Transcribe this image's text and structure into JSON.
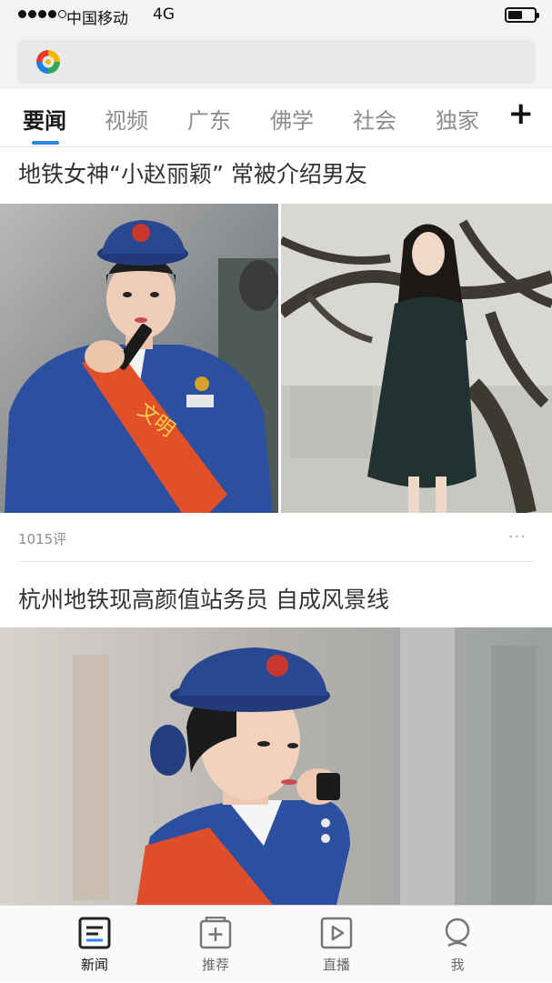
{
  "status_bar": {
    "carrier": "中国移动",
    "network": "4G"
  },
  "tabs": [
    {
      "label": "要闻",
      "active": true
    },
    {
      "label": "视频"
    },
    {
      "label": "广东"
    },
    {
      "label": "佛学"
    },
    {
      "label": "社会"
    },
    {
      "label": "独家"
    }
  ],
  "tab_add_label": "+",
  "articles": [
    {
      "title": "地铁女神“小赵丽颖” 常被介绍男友",
      "comments": "1015评",
      "more": "···"
    },
    {
      "title": "杭州地铁现高颜值站务员  自成风景线"
    }
  ],
  "photos": [
    "subway-attendant-with-walkie-talkie",
    "woman-under-tree-dark-sweater",
    "subway-attendant-closeup"
  ],
  "bottom_nav": [
    {
      "label": "新闻",
      "icon": "news-icon",
      "active": true
    },
    {
      "label": "推荐",
      "icon": "recommend-icon"
    },
    {
      "label": "直播",
      "icon": "live-icon"
    },
    {
      "label": "我",
      "icon": "profile-icon"
    }
  ],
  "colors": {
    "accent": "#2a86e8",
    "background": "#f3f3f3"
  }
}
